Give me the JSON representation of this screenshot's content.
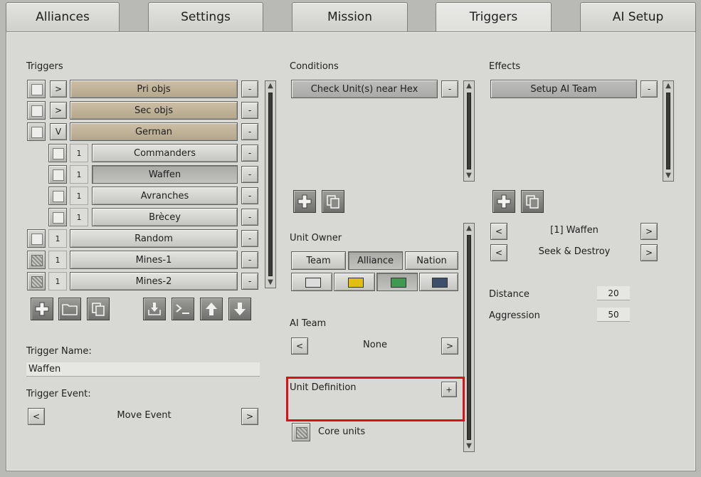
{
  "tabs": [
    {
      "label": "Alliances",
      "active": false
    },
    {
      "label": "Settings",
      "active": false
    },
    {
      "label": "Mission",
      "active": false
    },
    {
      "label": "Triggers",
      "active": true
    },
    {
      "label": "AI Setup",
      "active": false
    }
  ],
  "triggers": {
    "title": "Triggers",
    "rows": [
      {
        "expander": ">",
        "label": "Pri objs",
        "remove": "-"
      },
      {
        "expander": ">",
        "label": "Sec objs",
        "remove": "-"
      },
      {
        "expander": "V",
        "label": "German",
        "remove": "-"
      },
      {
        "expander": "1",
        "label": "Commanders",
        "remove": "-"
      },
      {
        "expander": "1",
        "label": "Waffen",
        "remove": "-"
      },
      {
        "expander": "1",
        "label": "Avranches",
        "remove": "-"
      },
      {
        "expander": "1",
        "label": "Brècey",
        "remove": "-"
      },
      {
        "expander": "1",
        "label": "Random",
        "remove": "-"
      },
      {
        "expander": "1",
        "label": "Mines-1",
        "remove": "-"
      },
      {
        "expander": "1",
        "label": "Mines-2",
        "remove": "-"
      }
    ],
    "trigger_name_label": "Trigger Name:",
    "trigger_name_value": "Waffen",
    "trigger_event_label": "Trigger Event:",
    "trigger_event_value": "Move Event",
    "prev": "<",
    "next": ">"
  },
  "conditions": {
    "title": "Conditions",
    "items": [
      {
        "label": "Check Unit(s) near Hex",
        "remove": "-"
      }
    ],
    "unit_owner_label": "Unit Owner",
    "owner_tabs": [
      "Team",
      "Alliance",
      "Nation"
    ],
    "owner_colors": [
      "#dcdcdc",
      "#e1be10",
      "#3e9a52",
      "#3d4f6a"
    ],
    "ai_team_label": "AI Team",
    "ai_team_value": "None",
    "prev": "<",
    "next": ">",
    "unit_definition_label": "Unit Definition",
    "unit_definition_add": "+",
    "core_units_label": "Core units"
  },
  "effects": {
    "title": "Effects",
    "items": [
      {
        "label": "Setup AI Team",
        "remove": "-"
      }
    ],
    "team_value": "[1] Waffen",
    "order_value": "Seek & Destroy",
    "prev": "<",
    "next": ">",
    "distance_label": "Distance",
    "distance_value": "20",
    "aggression_label": "Aggression",
    "aggression_value": "50"
  }
}
